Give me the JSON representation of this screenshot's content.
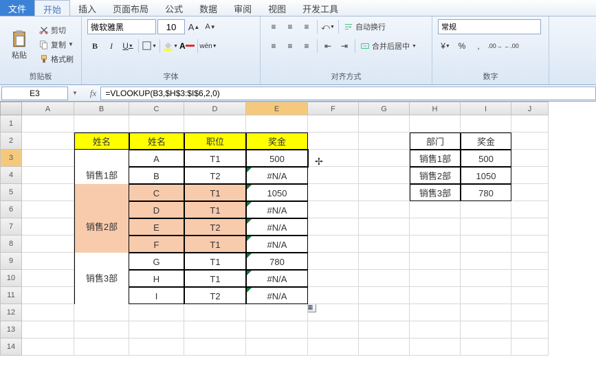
{
  "tabs": {
    "file": "文件",
    "home": "开始",
    "insert": "插入",
    "layout": "页面布局",
    "formula": "公式",
    "data": "数据",
    "review": "审阅",
    "view": "视图",
    "dev": "开发工具"
  },
  "clipboard": {
    "label": "剪贴板",
    "paste": "粘贴",
    "cut": "剪切",
    "copy": "复制",
    "format_painter": "格式刷"
  },
  "font": {
    "label": "字体",
    "name": "微软雅黑",
    "size": "10",
    "bold": "B",
    "italic": "I",
    "underline": "U"
  },
  "align": {
    "label": "对齐方式",
    "wrap": "自动换行",
    "merge": "合并后居中"
  },
  "number": {
    "label": "数字",
    "format": "常规"
  },
  "namebox": "E3",
  "formula": "=VLOOKUP(B3,$H$3:$I$6,2,0)",
  "cols": [
    "A",
    "B",
    "C",
    "D",
    "E",
    "F",
    "G",
    "H",
    "I",
    "J"
  ],
  "rows": [
    "1",
    "2",
    "3",
    "4",
    "5",
    "6",
    "7",
    "8",
    "9",
    "10",
    "11",
    "12",
    "13",
    "14"
  ],
  "main_headers": {
    "c1": "姓名",
    "c2": "姓名",
    "c3": "职位",
    "c4": "奖金"
  },
  "main_data": [
    {
      "dept": "销售1部",
      "rows": [
        {
          "name": "A",
          "pos": "T1",
          "bonus": "500"
        },
        {
          "name": "B",
          "pos": "T2",
          "bonus": "#N/A"
        }
      ],
      "peach": false
    },
    {
      "dept": "销售2部",
      "rows": [
        {
          "name": "C",
          "pos": "T1",
          "bonus": "1050"
        },
        {
          "name": "D",
          "pos": "T1",
          "bonus": "#N/A"
        },
        {
          "name": "E",
          "pos": "T2",
          "bonus": "#N/A"
        },
        {
          "name": "F",
          "pos": "T1",
          "bonus": "#N/A"
        }
      ],
      "peach": true
    },
    {
      "dept": "销售3部",
      "rows": [
        {
          "name": "G",
          "pos": "T1",
          "bonus": "780"
        },
        {
          "name": "H",
          "pos": "T1",
          "bonus": "#N/A"
        },
        {
          "name": "I",
          "pos": "T2",
          "bonus": "#N/A"
        }
      ],
      "peach": false
    }
  ],
  "side_headers": {
    "c1": "部门",
    "c2": "奖金"
  },
  "side_data": [
    {
      "dept": "销售1部",
      "bonus": "500"
    },
    {
      "dept": "销售2部",
      "bonus": "1050"
    },
    {
      "dept": "销售3部",
      "bonus": "780"
    }
  ],
  "chart_data": {
    "type": "table",
    "title": "VLOOKUP bonus lookup",
    "lookup": [
      {
        "dept": "销售1部",
        "bonus": 500
      },
      {
        "dept": "销售2部",
        "bonus": 1050
      },
      {
        "dept": "销售3部",
        "bonus": 780
      }
    ],
    "results": [
      {
        "name": "A",
        "pos": "T1",
        "dept": "销售1部",
        "bonus": 500
      },
      {
        "name": "B",
        "pos": "T2",
        "dept": "销售1部",
        "bonus": "#N/A"
      },
      {
        "name": "C",
        "pos": "T1",
        "dept": "销售2部",
        "bonus": 1050
      },
      {
        "name": "D",
        "pos": "T1",
        "dept": "销售2部",
        "bonus": "#N/A"
      },
      {
        "name": "E",
        "pos": "T2",
        "dept": "销售2部",
        "bonus": "#N/A"
      },
      {
        "name": "F",
        "pos": "T1",
        "dept": "销售2部",
        "bonus": "#N/A"
      },
      {
        "name": "G",
        "pos": "T1",
        "dept": "销售3部",
        "bonus": 780
      },
      {
        "name": "H",
        "pos": "T1",
        "dept": "销售3部",
        "bonus": "#N/A"
      },
      {
        "name": "I",
        "pos": "T2",
        "dept": "销售3部",
        "bonus": "#N/A"
      }
    ]
  }
}
